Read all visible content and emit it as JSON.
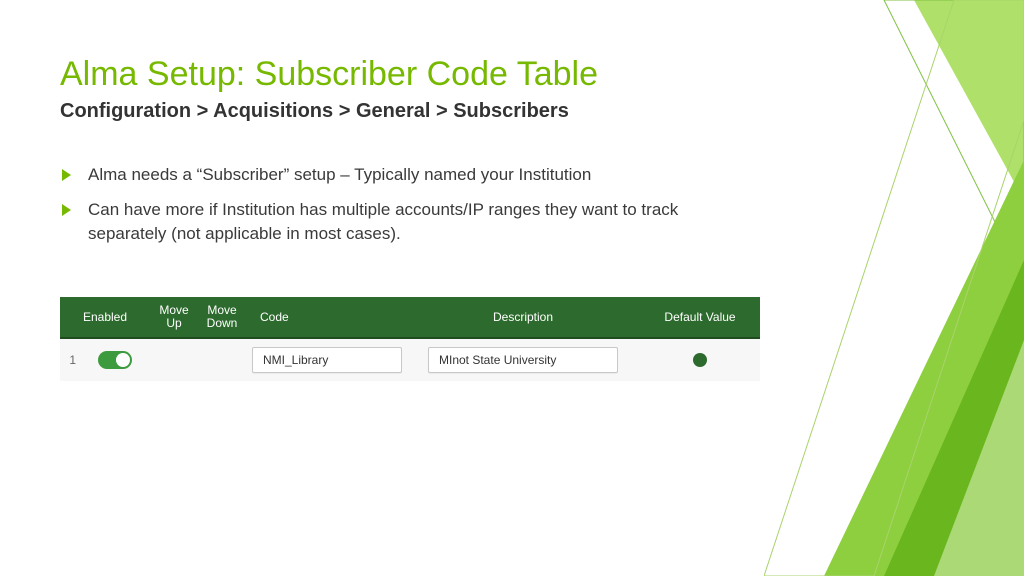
{
  "title": "Alma Setup: Subscriber Code Table",
  "subtitle": "Configuration > Acquisitions > General > Subscribers",
  "bullets": [
    "Alma needs a “Subscriber” setup – Typically named your Institution",
    "Can have more if Institution has multiple accounts/IP ranges they want to track separately (not applicable in most cases)."
  ],
  "table": {
    "headers": {
      "enabled": "Enabled",
      "moveUp": "Move Up",
      "moveDown": "Move Down",
      "code": "Code",
      "description": "Description",
      "defaultValue": "Default Value"
    },
    "rows": [
      {
        "num": "1",
        "enabled": true,
        "code": "NMI_Library",
        "description": "MInot State University",
        "default": true
      }
    ]
  }
}
